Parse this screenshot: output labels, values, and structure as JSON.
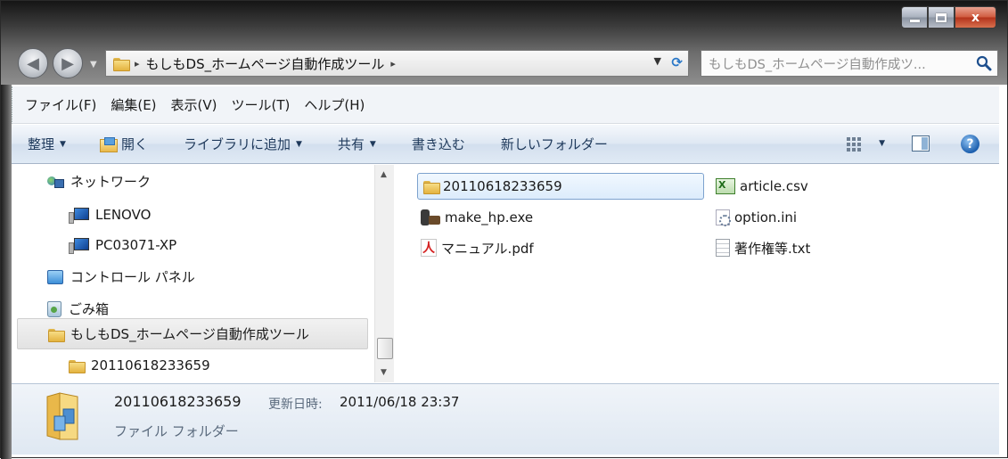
{
  "window": {
    "controls": {
      "minimize": "minimize",
      "maximize": "maximize",
      "close": "x"
    }
  },
  "address": {
    "path": "もしもDS_ホームページ自動作成ツール",
    "separator": "▸"
  },
  "search": {
    "placeholder": "もしもDS_ホームページ自動作成ツ..."
  },
  "menu": {
    "items": [
      "ファイル(F)",
      "編集(E)",
      "表示(V)",
      "ツール(T)",
      "ヘルプ(H)"
    ]
  },
  "commands": {
    "organize": "整理",
    "open": "開く",
    "add_to_library": "ライブラリに追加",
    "share": "共有",
    "burn": "書き込む",
    "new_folder": "新しいフォルダー"
  },
  "navigation": {
    "items": [
      {
        "label": "ネットワーク",
        "icon": "network-icon"
      },
      {
        "label": "LENOVO",
        "icon": "computer-icon"
      },
      {
        "label": "PC03071-XP",
        "icon": "computer-icon"
      },
      {
        "label": "コントロール パネル",
        "icon": "control-panel-icon"
      },
      {
        "label": "ごみ箱",
        "icon": "recycle-bin-icon"
      },
      {
        "label": "もしもDS_ホームページ自動作成ツール",
        "icon": "folder-icon",
        "selected": true
      },
      {
        "label": "20110618233659",
        "icon": "folder-icon"
      }
    ]
  },
  "files": [
    {
      "name": "20110618233659",
      "icon": "folder-icon",
      "selected": true
    },
    {
      "name": "make_hp.exe",
      "icon": "exe-icon"
    },
    {
      "name": "マニュアル.pdf",
      "icon": "pdf-icon"
    },
    {
      "name": "article.csv",
      "icon": "csv-icon"
    },
    {
      "name": "option.ini",
      "icon": "ini-icon"
    },
    {
      "name": "著作権等.txt",
      "icon": "txt-icon"
    }
  ],
  "details": {
    "name": "20110618233659",
    "modified_label": "更新日時:",
    "modified_value": "2011/06/18 23:37",
    "type": "ファイル フォルダー"
  },
  "colors": {
    "title_dark": "#151515",
    "command_bar": "#dfe8f3",
    "selection": "#dcecfc",
    "close_button": "#d05a3d"
  }
}
